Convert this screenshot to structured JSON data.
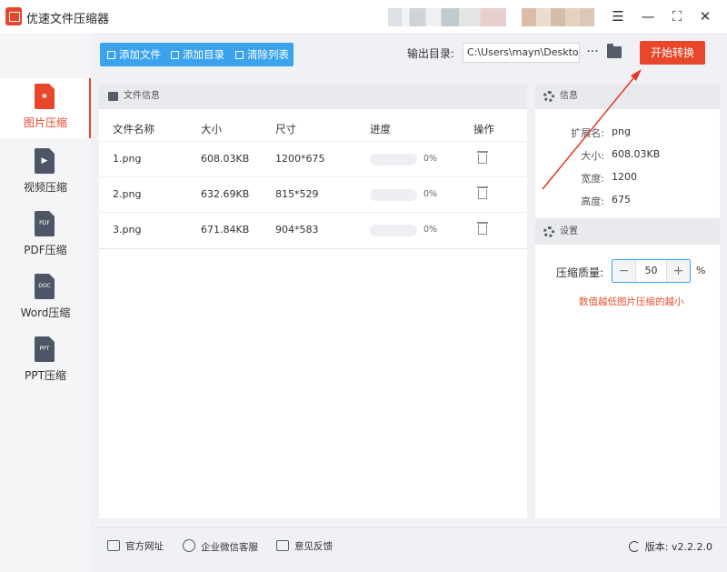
{
  "window": {
    "title": "优速文件压缩器",
    "controls": [
      "menu-icon",
      "minimize-icon",
      "maximize-icon",
      "close-icon"
    ]
  },
  "sidebar": {
    "items": [
      {
        "label": "图片压缩",
        "icon": "image-file-icon",
        "active": true
      },
      {
        "label": "视频压缩",
        "icon": "video-file-icon",
        "active": false
      },
      {
        "label": "PDF压缩",
        "icon": "pdf-file-icon",
        "icon_text": "PDF",
        "active": false
      },
      {
        "label": "Word压缩",
        "icon": "doc-file-icon",
        "icon_text": "DOC",
        "active": false
      },
      {
        "label": "PPT压缩",
        "icon": "ppt-file-icon",
        "icon_text": "PPT",
        "active": false
      }
    ]
  },
  "toolbar": {
    "add_file": "添加文件",
    "add_dir": "添加目录",
    "clear_list": "清除列表",
    "output_label": "输出目录:",
    "output_path": "C:\\Users\\mayn\\Desktop",
    "more": "···",
    "start": "开始转换"
  },
  "files_panel": {
    "title": "文件信息",
    "columns": [
      "文件名称",
      "大小",
      "尺寸",
      "进度",
      "操作"
    ],
    "rows": [
      {
        "name": "1.png",
        "size": "608.03KB",
        "dim": "1200*675",
        "progress": "0%",
        "progress_value": 0
      },
      {
        "name": "2.png",
        "size": "632.69KB",
        "dim": "815*529",
        "progress": "0%",
        "progress_value": 0
      },
      {
        "name": "3.png",
        "size": "671.84KB",
        "dim": "904*583",
        "progress": "0%",
        "progress_value": 0
      }
    ]
  },
  "info_panel": {
    "title": "信息",
    "rows": [
      {
        "key": "扩展名:",
        "value": "png"
      },
      {
        "key": "大小:",
        "value": "608.03KB"
      },
      {
        "key": "宽度:",
        "value": "1200"
      },
      {
        "key": "高度:",
        "value": "675"
      }
    ]
  },
  "settings_panel": {
    "title": "设置",
    "quality_label": "压缩质量:",
    "quality_value": "50",
    "minus": "−",
    "plus": "+",
    "unit": "%",
    "hint": "数值越低图片压缩的越小"
  },
  "statusbar": {
    "website": "官方网址",
    "wechat": "企业微信客服",
    "feedback": "意见反馈",
    "version": "版本: v2.2.2.0"
  },
  "colors": {
    "accent": "#e8472b",
    "toolbar_button": "#3ba3ee",
    "hint": "#e0502f"
  }
}
